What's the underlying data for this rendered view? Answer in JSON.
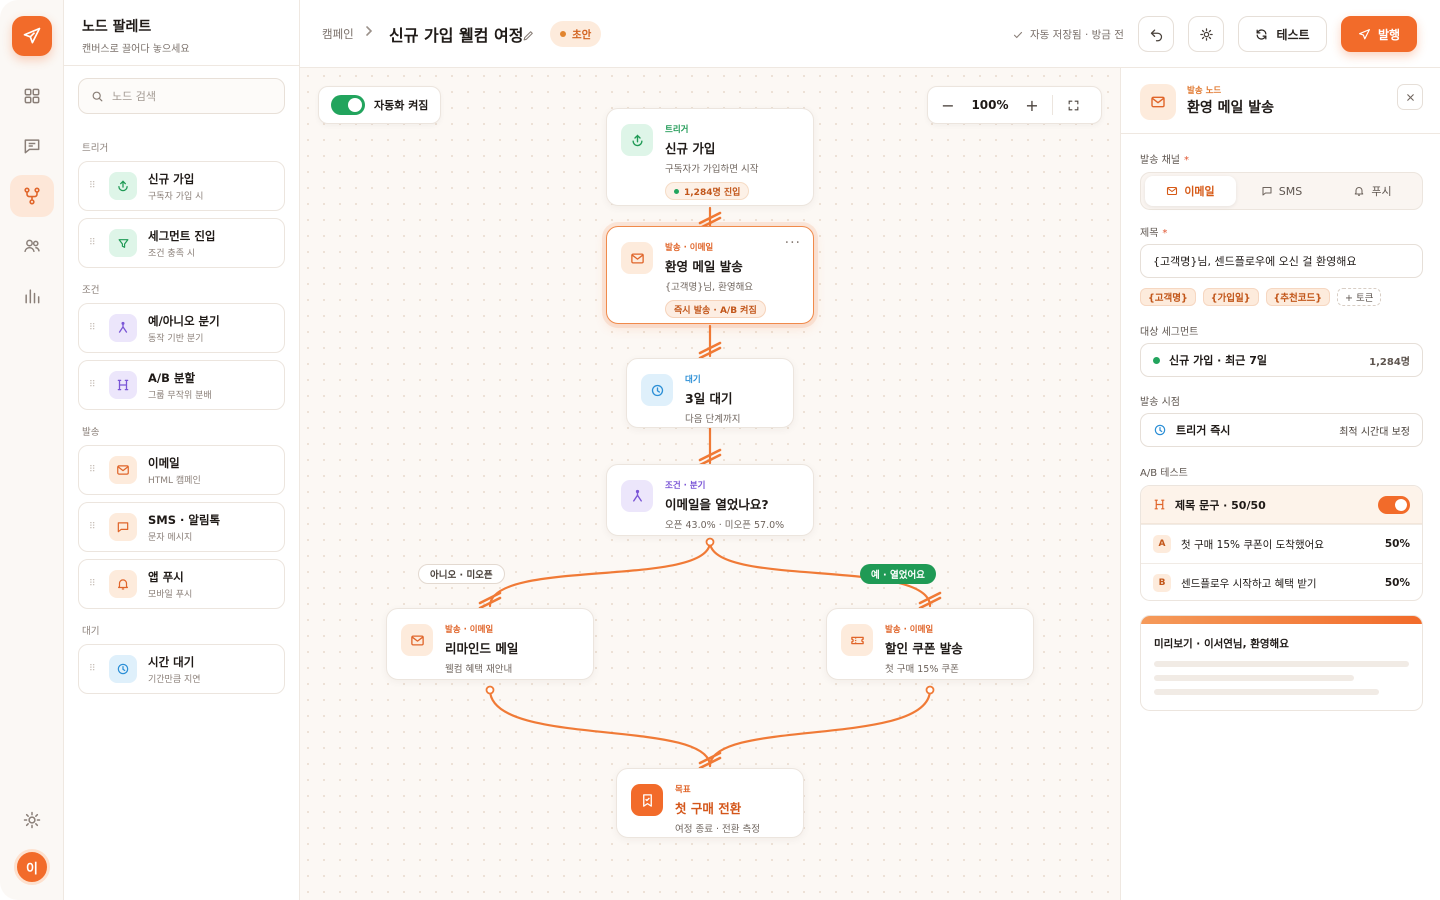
{
  "rail": {
    "avatar_initial": "이"
  },
  "palette": {
    "title": "노드 팔레트",
    "subtitle": "캔버스로 끌어다 놓으세요",
    "search_placeholder": "노드 검색",
    "sections": [
      {
        "label": "트리거"
      },
      {
        "label": "조건"
      },
      {
        "label": "발송"
      },
      {
        "label": "대기"
      }
    ],
    "items": [
      {
        "name": "신규 가입",
        "desc": "구독자 가입 시"
      },
      {
        "name": "세그먼트 진입",
        "desc": "조건 충족 시"
      },
      {
        "name": "예/아니오 분기",
        "desc": "동작 기반 분기"
      },
      {
        "name": "A/B 분할",
        "desc": "그룹 무작위 분배"
      },
      {
        "name": "이메일",
        "desc": "HTML 캠페인"
      },
      {
        "name": "SMS · 알림톡",
        "desc": "문자 메시지"
      },
      {
        "name": "앱 푸시",
        "desc": "모바일 푸시"
      },
      {
        "name": "시간 대기",
        "desc": "기간만큼 지연"
      }
    ]
  },
  "header": {
    "breadcrumb": "캠페인",
    "title": "신규 가입 웰컴 여정",
    "status": "초안",
    "autosave": "자동 저장됨 · 방금 전",
    "test_label": "테스트",
    "publish_label": "발행"
  },
  "canvas": {
    "automation_label": "자동화 켜짐",
    "zoom": "100%",
    "nodes": {
      "trigger": {
        "kind": "트리거",
        "title": "신규 가입",
        "sub": "구독자가 가입하면 시작",
        "pill": "1,284명 진입"
      },
      "welcome": {
        "kind": "발송 · 이메일",
        "title": "환영 메일 발송",
        "sub": "{고객명}님, 환영해요",
        "pill": "즉시 발송 · A/B 켜짐"
      },
      "wait": {
        "kind": "대기",
        "title": "3일 대기",
        "sub": "다음 단계까지"
      },
      "branch": {
        "kind": "조건 · 분기",
        "title": "이메일을 열었나요?",
        "sub": "오픈 43.0% · 미오픈 57.0%"
      },
      "remind": {
        "kind": "발송 · 이메일",
        "title": "리마인드 메일",
        "sub": "웰컴 혜택 재안내"
      },
      "coupon": {
        "kind": "발송 · 이메일",
        "title": "할인 쿠폰 발송",
        "sub": "첫 구매 15% 쿠폰"
      },
      "goal": {
        "kind": "목표",
        "title": "첫 구매 전환",
        "sub": "여정 종료 · 전환 측정"
      }
    },
    "edge_labels": {
      "no": "아니오 · 미오픈",
      "yes": "예 · 열었어요"
    }
  },
  "inspector": {
    "kind": "발송 노드",
    "title": "환영 메일 발송",
    "channel_label": "발송 채널",
    "channels": [
      "이메일",
      "SMS",
      "푸시"
    ],
    "subject_label": "제목",
    "subject_value": "{고객명}님, 센드플로우에 오신 걸 환영해요",
    "tokens": [
      "{고객명}",
      "{가입일}",
      "{추천코드}",
      "+ 토큰"
    ],
    "segment_label": "대상 세그먼트",
    "segment_value": "신규 가입 · 최근 7일",
    "segment_count": "1,284명",
    "timing_label": "발송 시점",
    "timing_value": "트리거 즉시",
    "timing_note": "최적 시간대 보정",
    "ab_label": "A/B 테스트",
    "ab_title": "제목 문구 · 50/50",
    "ab_variants": [
      {
        "letter": "A",
        "text": "첫 구매 15% 쿠폰이 도착했어요",
        "pct": "50%"
      },
      {
        "letter": "B",
        "text": "센드플로우 시작하고 혜택 받기",
        "pct": "50%"
      }
    ],
    "preview_title": "미리보기 · 이서연님, 환영해요"
  },
  "colors": {
    "accent": "#f26b2a",
    "success": "#22a45d",
    "edge": "#f07a36"
  }
}
